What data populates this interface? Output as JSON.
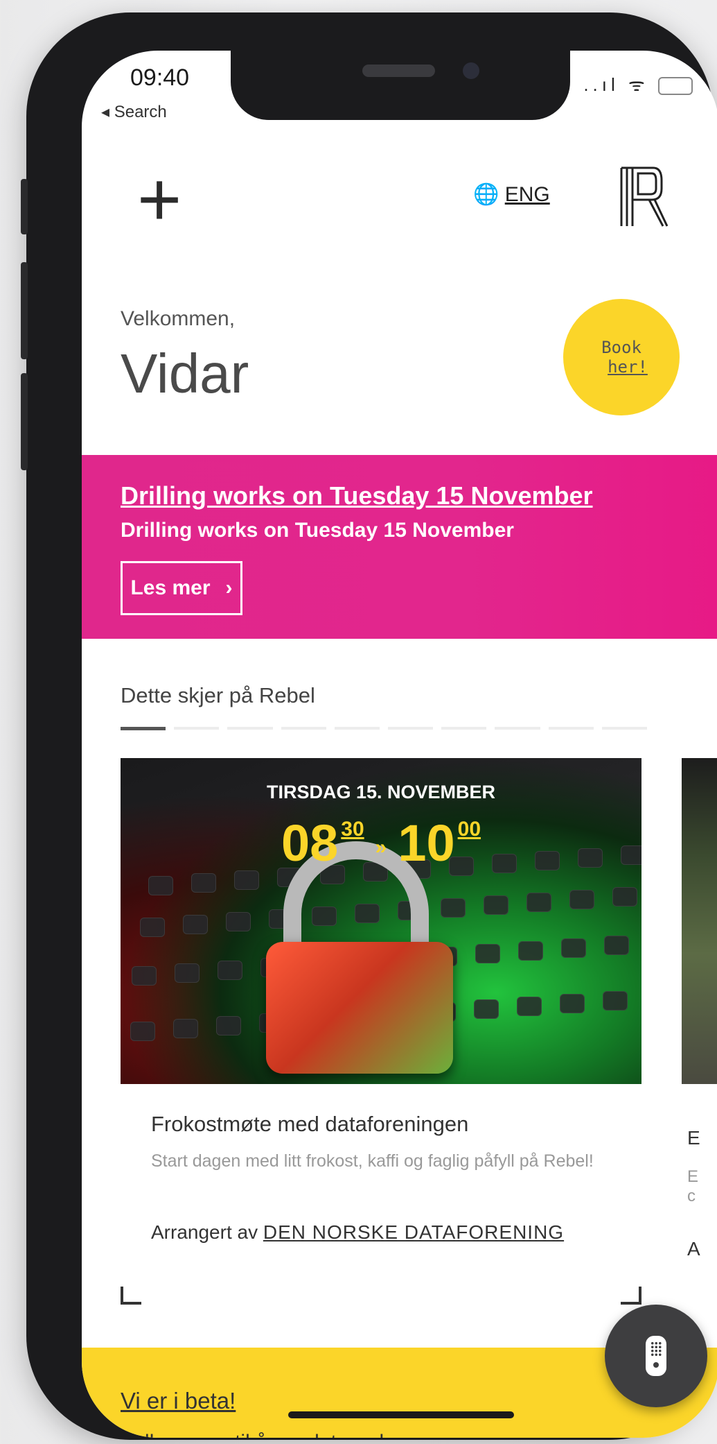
{
  "status_bar": {
    "time": "09:40",
    "back_label": "◂ Search",
    "signal": "..ıl",
    "wifi": "ᯤ"
  },
  "header": {
    "add_icon": "+",
    "language_globe": "🌐",
    "language_label": "ENG",
    "logo_icon": "rebel-logo-icon"
  },
  "greeting": {
    "welcome": "Velkommen,",
    "name": "Vidar",
    "book_line1": "Book",
    "book_line2": "her!"
  },
  "notice": {
    "title": "Drilling works on Tuesday 15 November",
    "subtitle": "Drilling works on Tuesday 15 November",
    "button_label": "Les mer",
    "button_chevron": "›"
  },
  "events_section": {
    "title": "Dette skjer på Rebel",
    "pager_count": 10,
    "active_page": 0
  },
  "event_card": {
    "date": "TIRSDAG 15. NOVEMBER",
    "start_hour": "08",
    "start_min": "30",
    "separator": "»",
    "end_hour": "10",
    "end_min": "00",
    "title": "Frokostmøte med dataforeningen",
    "description": "Start dagen med litt frokost, kaffi og faglig påfyll på Rebel!",
    "organizer_prefix": "Arrangert av",
    "organizer_name": "DEN NORSKE DATAFORENING"
  },
  "next_card": {
    "title_initial": "E",
    "desc_initial": "E",
    "desc_initial2": "c",
    "org_initial": "A"
  },
  "beta": {
    "title": "Vi er i beta!",
    "text": "Velkommen til å oppdatere denne appen"
  },
  "colors": {
    "accent_yellow": "#fbd529",
    "banner_pink": "#e0278c"
  }
}
